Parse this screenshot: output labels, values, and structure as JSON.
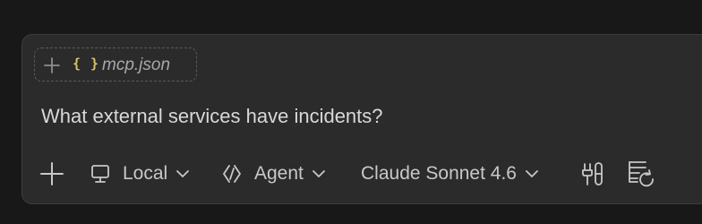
{
  "context_chip": {
    "add_icon": "plus-icon",
    "file_icon": "json-braces-icon",
    "file_icon_glyph": "{ }",
    "filename": "mcp.json"
  },
  "prompt": {
    "text": "What external services have incidents?"
  },
  "toolbar": {
    "add_icon": "plus-icon",
    "environment": {
      "icon": "monitor-icon",
      "label": "Local"
    },
    "mode": {
      "icon": "agent-icon",
      "label": "Agent"
    },
    "model": {
      "label": "Claude Sonnet 4.6"
    },
    "tools_icon": "tools-icon",
    "history_icon": "history-refresh-icon"
  },
  "colors": {
    "background": "#181818",
    "panel": "#2b2b2b",
    "text": "#d8d8d8",
    "braces": "#d6c46a"
  }
}
